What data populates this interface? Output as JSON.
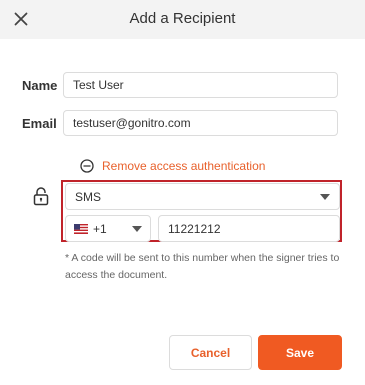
{
  "dialog": {
    "title": "Add a Recipient"
  },
  "form": {
    "name_label": "Name",
    "name_value": "Test User",
    "email_label": "Email",
    "email_value": "testuser@gonitro.com"
  },
  "auth": {
    "remove_label": "Remove access authentication",
    "method_value": "SMS",
    "country_code": "+1",
    "phone_value": "11221212",
    "note": "* A code will be sent to this number when the signer tries to access the document."
  },
  "actions": {
    "cancel_label": "Cancel",
    "save_label": "Save"
  },
  "colors": {
    "accent": "#f05a22",
    "link": "#e8612c",
    "highlight_border": "#c0232a",
    "header_bg": "#f3f3f3"
  },
  "icons": {
    "close": "close-icon",
    "remove": "minus-circle-icon",
    "lock": "lock-icon",
    "dropdown": "caret-down-icon",
    "flag": "us-flag-icon"
  }
}
